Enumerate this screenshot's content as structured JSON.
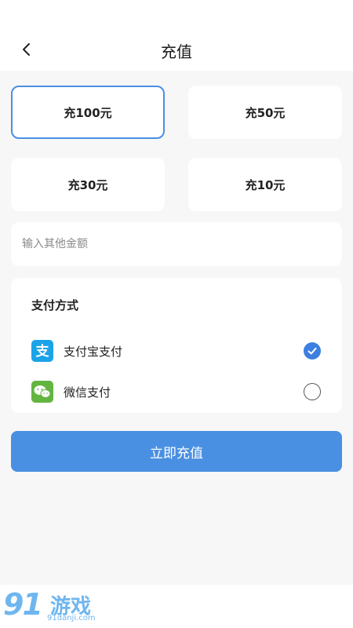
{
  "header": {
    "title": "充值",
    "back_icon": "chevron-left-icon"
  },
  "amounts": {
    "items": [
      {
        "label": "充100元",
        "selected": true
      },
      {
        "label": "充50元",
        "selected": false
      },
      {
        "label": "充30元",
        "selected": false
      },
      {
        "label": "充10元",
        "selected": false
      }
    ],
    "other_placeholder": "输入其他金额",
    "selected_color": "#4a90e2"
  },
  "payment": {
    "title": "支付方式",
    "methods": [
      {
        "label": "支付宝支付",
        "icon": "alipay-icon",
        "color": "#1aa3e8",
        "checked": true
      },
      {
        "label": "微信支付",
        "icon": "wechat-icon",
        "color": "#63b540",
        "checked": false
      }
    ]
  },
  "submit": {
    "label": "立即充值",
    "color": "#4a90e2"
  },
  "watermark": {
    "big": "91",
    "text": "游戏",
    "url": "91danji.com"
  }
}
